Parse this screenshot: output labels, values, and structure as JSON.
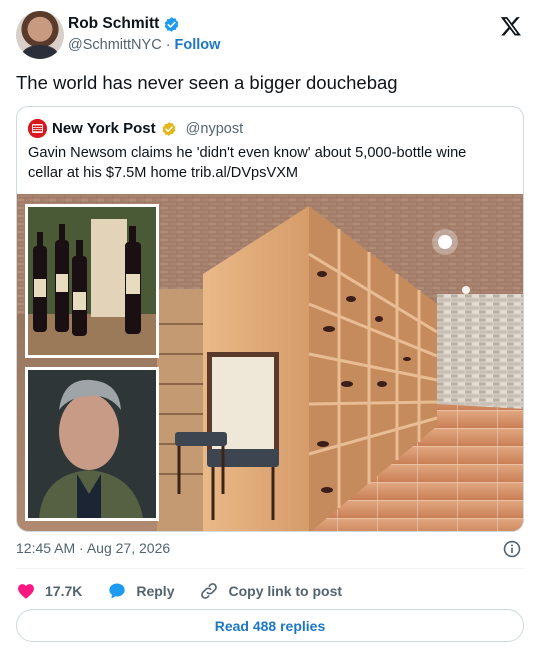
{
  "author": {
    "name": "Rob Schmitt",
    "handle": "@SchmittNYC",
    "separator": "·",
    "follow_label": "Follow"
  },
  "tweet": {
    "text": "The world has never seen a bigger douchebag",
    "time": "12:45 AM",
    "separator": "·",
    "date": "Aug 27, 2026"
  },
  "quote": {
    "name": "New York Post",
    "handle": "@nypost",
    "logo_text": "NEW YORK POST",
    "text": "Gavin Newsom claims he 'didn't even know' about 5,000-bottle wine cellar at his $7.5M home trib.al/DVpsVXM"
  },
  "actions": {
    "likes": "17.7K",
    "reply_label": "Reply",
    "copy_label": "Copy link to post"
  },
  "read_replies_label": "Read 488 replies",
  "colors": {
    "like_red": "#f91880",
    "link_blue": "#1d77c4",
    "verified_blue": "#1d9bf0",
    "gold_badge": "#e2b719"
  },
  "icons": [
    "verified-badge-icon",
    "x-logo-icon",
    "gold-verified-badge-icon",
    "info-icon",
    "heart-icon",
    "reply-bubble-icon",
    "link-icon"
  ]
}
